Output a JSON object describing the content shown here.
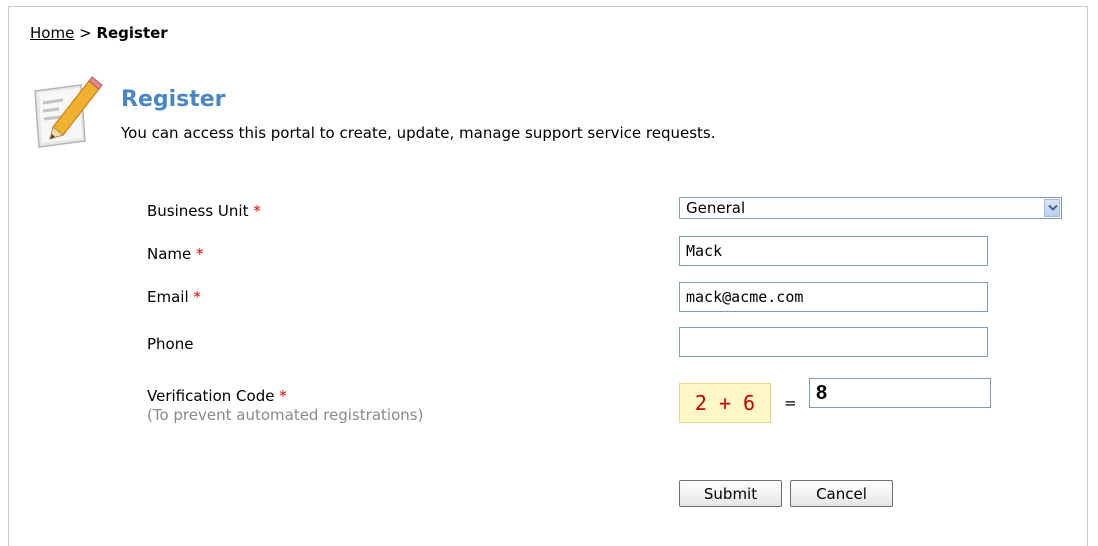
{
  "breadcrumb": {
    "home": "Home",
    "separator": ">",
    "current": "Register"
  },
  "header": {
    "icon": "edit-document-icon",
    "title": "Register",
    "description": "You can access this portal to create, update, manage support service requests."
  },
  "form": {
    "required_marker": "*",
    "business_unit": {
      "label": "Business Unit",
      "value": "General"
    },
    "name": {
      "label": "Name",
      "value": "Mack"
    },
    "email": {
      "label": "Email",
      "value": "mack@acme.com"
    },
    "phone": {
      "label": "Phone",
      "value": ""
    },
    "verification": {
      "label": "Verification Code",
      "hint": "(To prevent automated registrations)",
      "captcha": "2 + 6",
      "equals": "=",
      "value": "8"
    }
  },
  "actions": {
    "submit": "Submit",
    "cancel": "Cancel"
  },
  "colors": {
    "title": "#4a86c2",
    "required": "#e00000",
    "captcha_text": "#c80000",
    "captcha_bg": "#fef7c8"
  }
}
